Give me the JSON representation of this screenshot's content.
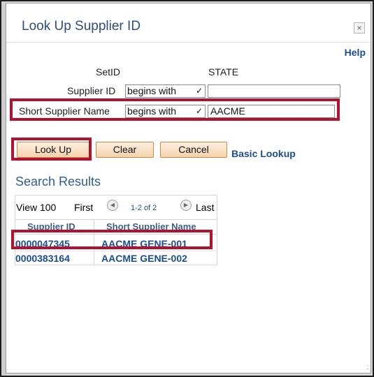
{
  "dialog": {
    "title": "Look Up Supplier ID",
    "close_label": "×",
    "help_label": "Help"
  },
  "form": {
    "setid_label": "SetID",
    "setid_value": "STATE",
    "supplier_id_label": "Supplier ID",
    "supplier_id_operator": "begins with",
    "supplier_id_value": "",
    "short_name_label": "Short Supplier Name",
    "short_name_operator": "begins with",
    "short_name_value": "AACME"
  },
  "buttons": {
    "lookup": "Look Up",
    "clear": "Clear",
    "cancel": "Cancel",
    "basic_lookup": "Basic Lookup"
  },
  "results": {
    "title": "Search Results",
    "view": "View 100",
    "first": "First",
    "range": "1-2 of 2",
    "last": "Last",
    "columns": [
      "Supplier ID",
      "Short Supplier Name"
    ],
    "rows": [
      {
        "supplier_id": "0000047345",
        "short_name": "AACME GENE-001"
      },
      {
        "supplier_id": "0000383164",
        "short_name": "AACME GENE-002"
      }
    ]
  },
  "colors": {
    "highlight": "#b0122f",
    "link": "#1a4e94",
    "button_fill": "#f5d2ac"
  }
}
